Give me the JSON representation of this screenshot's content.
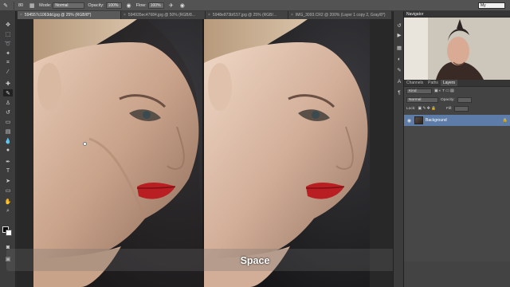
{
  "options_bar": {
    "mode_label": "Mode:",
    "mode_value": "Normal",
    "opacity_label": "Opacity:",
    "opacity_value": "100%",
    "flow_label": "Flow:",
    "flow_value": "100%",
    "brush_size": "80",
    "workspace": "My"
  },
  "tabs": [
    {
      "label": "594557c1063dd.jpg @ 25% (RGB/8*)",
      "active": true
    },
    {
      "label": "594935ec47684.jpg @ 50% (RGB/8...",
      "active": false
    },
    {
      "label": "5948e873bf157.jpg @ 25% (RGB/...",
      "active": false
    },
    {
      "label": "IMG_3093.CR2 @ 200% (Layer 1 copy 2, Gray/8*)",
      "active": false
    }
  ],
  "panels": {
    "navigator_title": "Navigator",
    "layer_tabs": [
      "Channels",
      "Paths",
      "Layers"
    ],
    "kind_label": "Kind",
    "blend_mode": "Normal",
    "opacity_label": "Opacity:",
    "lock_label": "Lock:",
    "fill_label": "Fill:",
    "layer_name": "Background"
  },
  "overlay": {
    "key": "Space"
  },
  "icons": {
    "eye": "eye-icon",
    "lock": "lock-icon",
    "brush": "brush-icon"
  }
}
